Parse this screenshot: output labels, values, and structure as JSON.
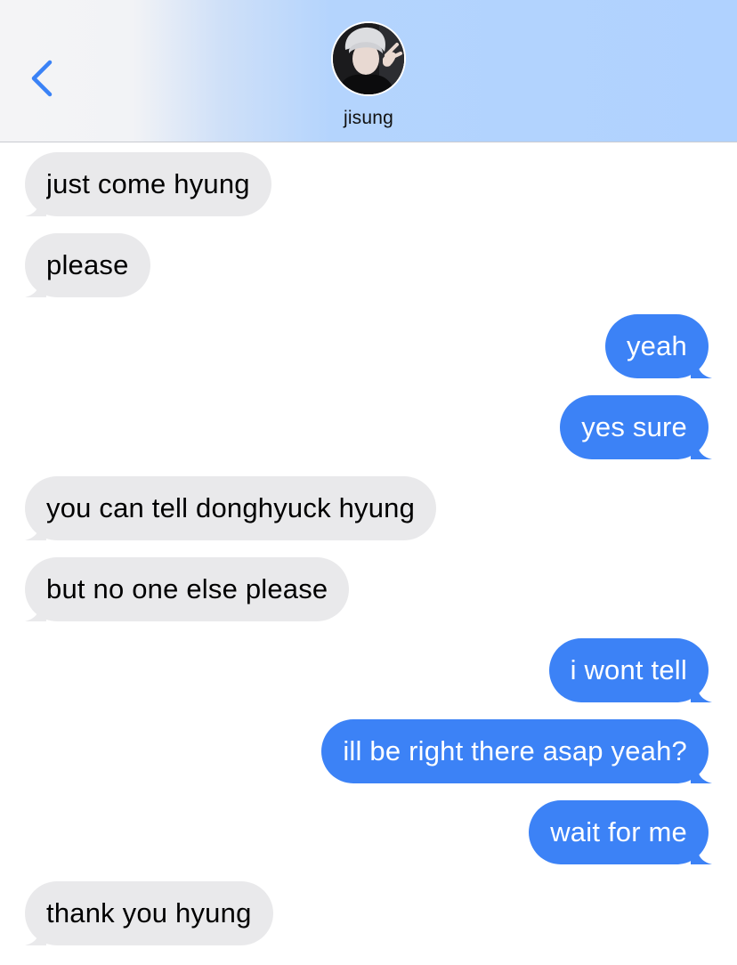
{
  "header": {
    "contact_name": "jisung",
    "back_icon": "chevron-left-icon",
    "avatar_icon": "contact-avatar"
  },
  "colors": {
    "incoming_bubble": "#e9e9eb",
    "outgoing_bubble": "#3c82f6",
    "back_chevron": "#3a82f6"
  },
  "messages": [
    {
      "direction": "incoming",
      "text": "just come hyung"
    },
    {
      "direction": "incoming",
      "text": "please"
    },
    {
      "direction": "outgoing",
      "text": "yeah"
    },
    {
      "direction": "outgoing",
      "text": "yes sure"
    },
    {
      "direction": "incoming",
      "text": "you can tell donghyuck hyung"
    },
    {
      "direction": "incoming",
      "text": "but no one else please"
    },
    {
      "direction": "outgoing",
      "text": "i wont tell"
    },
    {
      "direction": "outgoing",
      "text": "ill be right there asap yeah?"
    },
    {
      "direction": "outgoing",
      "text": "wait for me"
    },
    {
      "direction": "incoming",
      "text": "thank you hyung"
    }
  ]
}
